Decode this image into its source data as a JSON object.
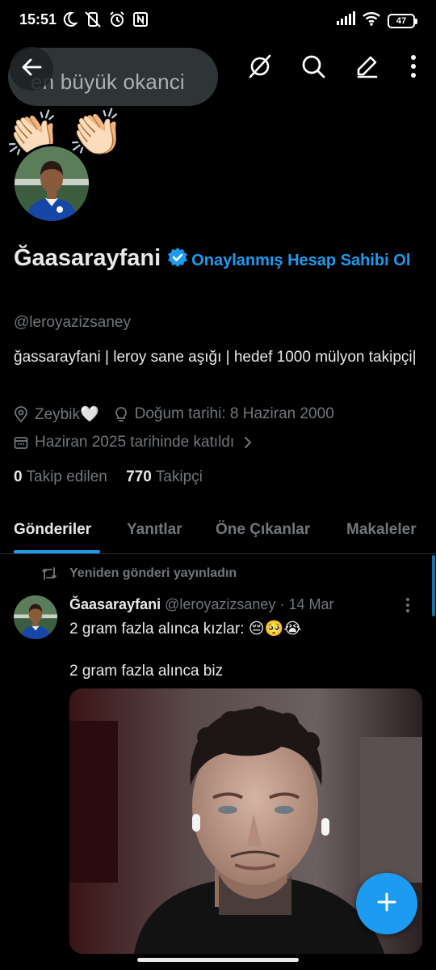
{
  "status_bar": {
    "time": "15:51",
    "left_icons": [
      "moon-icon",
      "no-vibrate-icon",
      "alarm-icon",
      "nfc-icon"
    ],
    "right_icons": [
      "signal-icon",
      "wifi-icon"
    ],
    "battery": "47"
  },
  "top_bar": {
    "search_text": "en büyük okanci",
    "actions": [
      "grok-icon",
      "search-icon",
      "edit-icon",
      "more-vertical-icon"
    ]
  },
  "header": {
    "emoji": [
      "👏🏻",
      "👏🏻"
    ]
  },
  "profile": {
    "name": "Ğaasarayfani",
    "verify_link": "Onaylanmış Hesap Sahibi Ol",
    "handle": "@leroyazizsaney",
    "bio": "ğassarayfani | leroy sane aşığı | hedef 1000 mülyon takipçi|",
    "location": "Zeybik🤍",
    "birthday": "Doğum tarihi: 8 Haziran 2000",
    "joined": "Haziran 2025 tarihinde katıldı",
    "following_count": "0",
    "following_label": "Takip edilen",
    "followers_count": "770",
    "followers_label": "Takipçi"
  },
  "tabs": [
    {
      "label": "Gönderiler",
      "active": true
    },
    {
      "label": "Yanıtlar",
      "active": false
    },
    {
      "label": "Öne Çıkanlar",
      "active": false
    },
    {
      "label": "Makaleler",
      "active": false
    }
  ],
  "post": {
    "repost_label": "Yeniden gönderi yayınladın",
    "author_name": "Ğaasarayfani",
    "author_handle": "@leroyazizsaney",
    "date": "· 14 Mar",
    "text_line1": "2 gram fazla alınca kızlar: 😔🥺😭",
    "text_line2": "2 gram fazla alınca biz"
  },
  "colors": {
    "accent": "#1d9bf0",
    "background": "#000000",
    "text_primary": "#e7e9ea",
    "text_secondary": "#71767b",
    "border": "#2f3336"
  }
}
